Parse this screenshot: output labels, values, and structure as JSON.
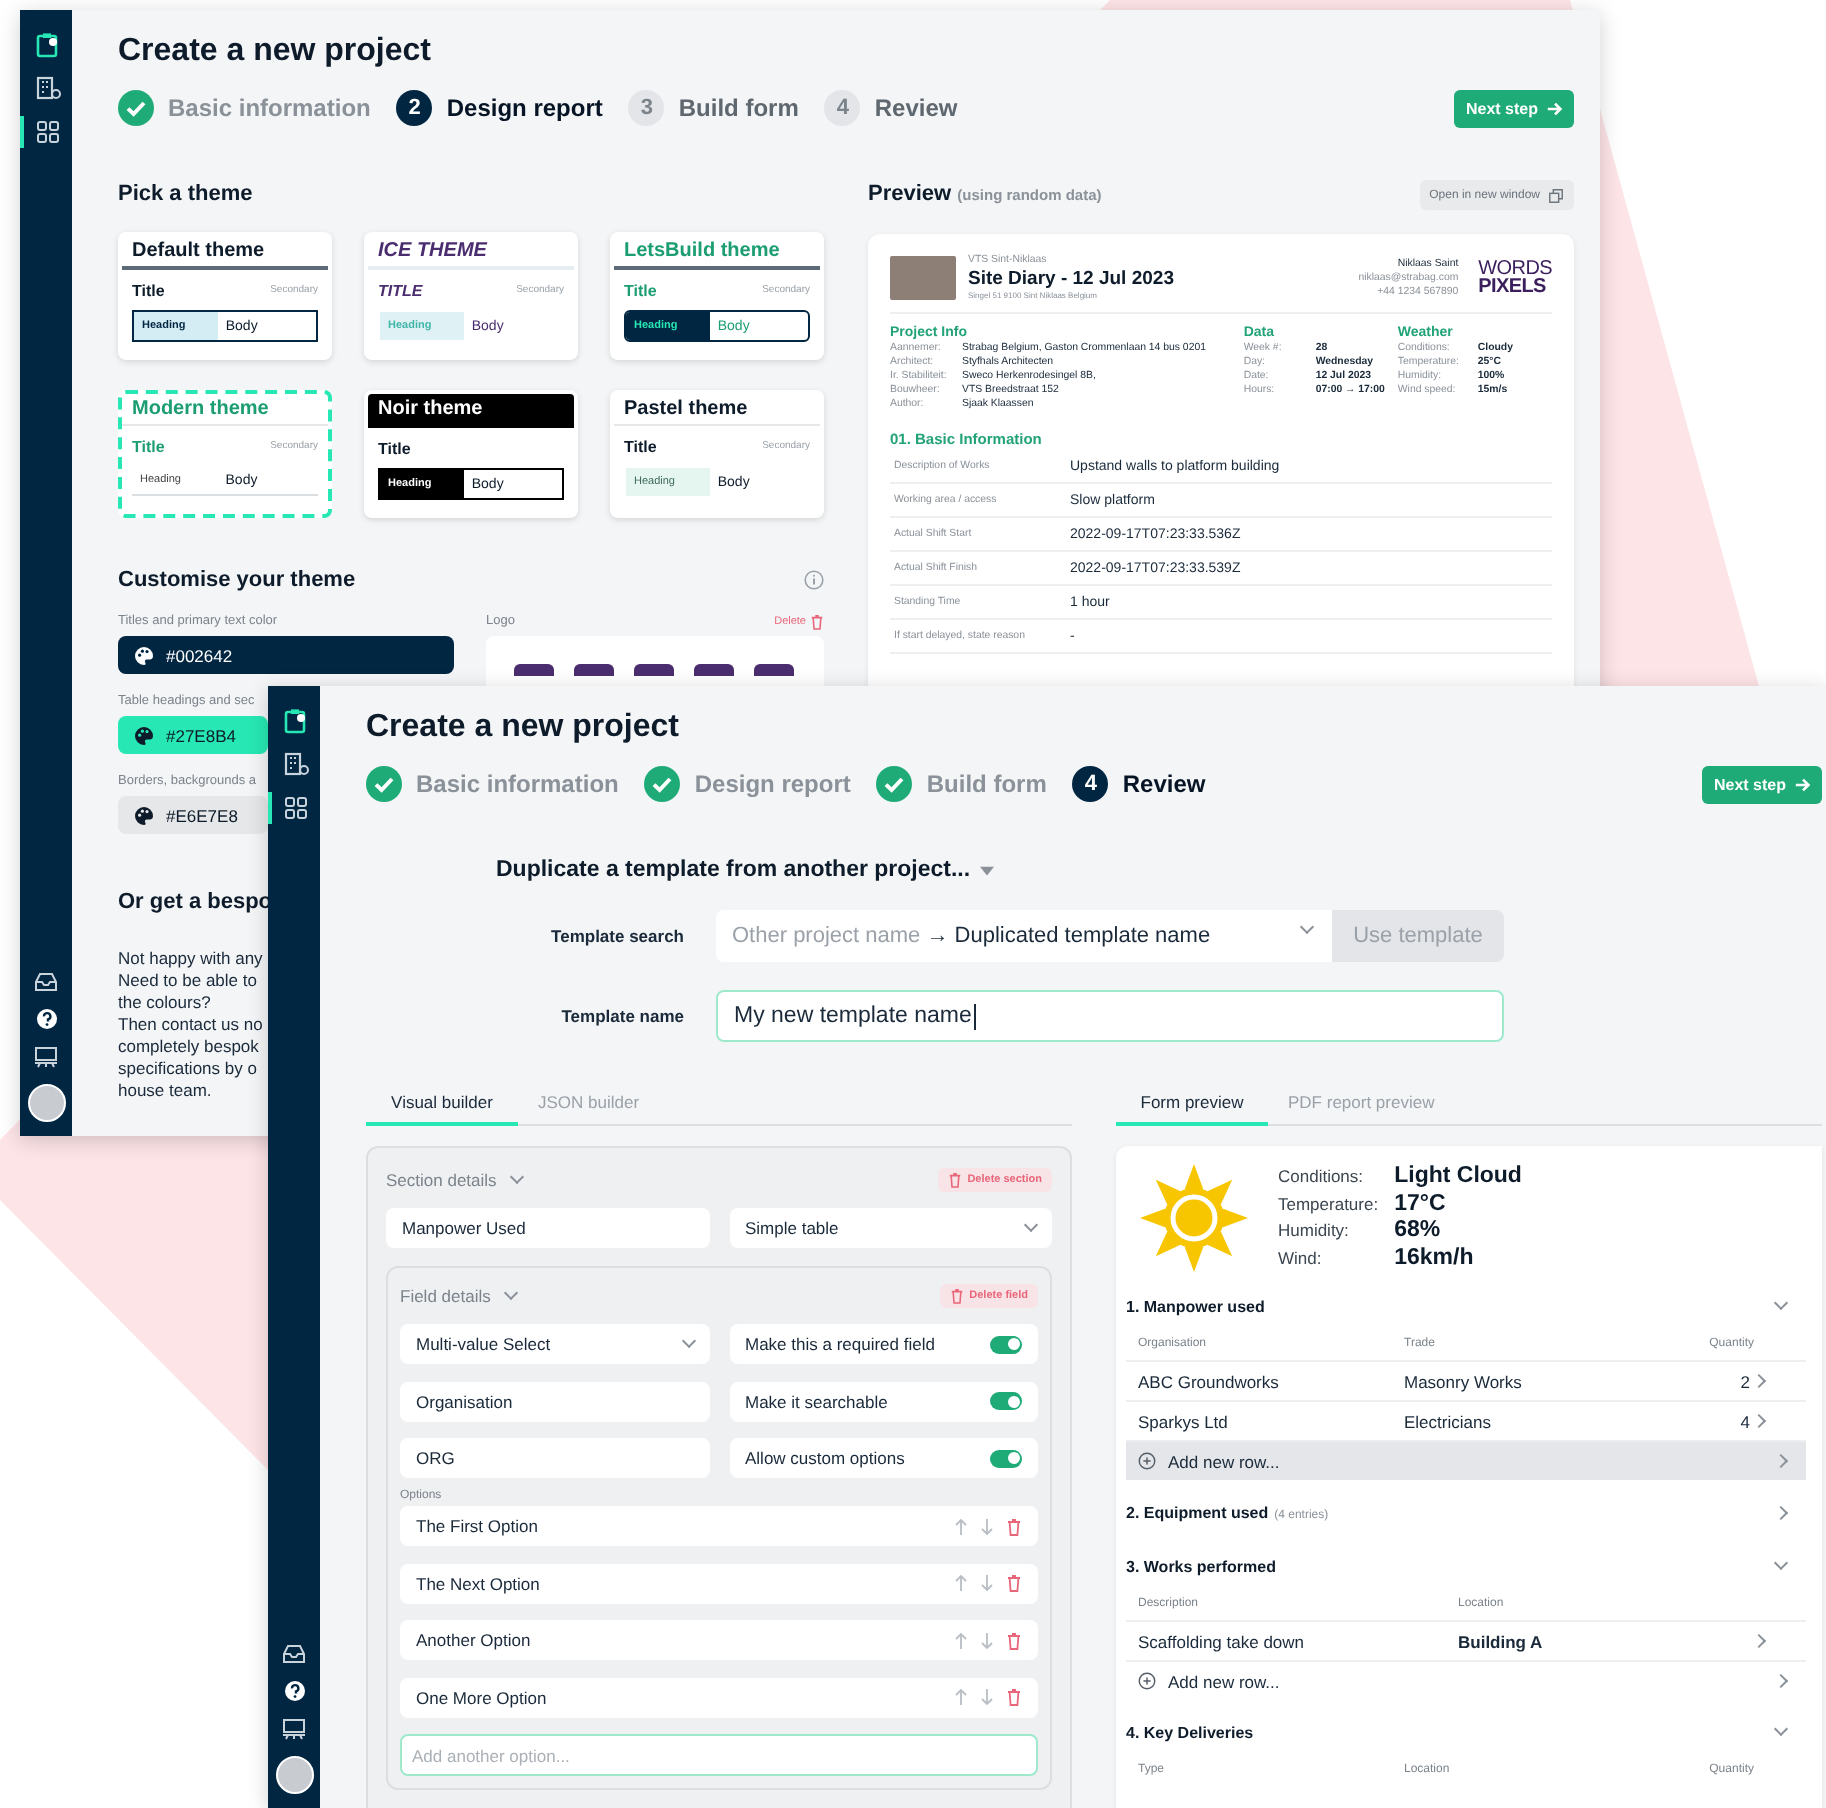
{
  "back_window": {
    "sidebar_items": [
      {
        "selected": false
      },
      {
        "selected": false
      },
      {
        "selected": true
      }
    ],
    "title": "Create a new project",
    "steps": [
      {
        "label": "Basic information",
        "done": true,
        "selected": false
      },
      {
        "number": "2",
        "label": "Design report",
        "done": false,
        "selected": true
      },
      {
        "number": "3",
        "label": "Build form",
        "done": false,
        "selected": false
      },
      {
        "number": "4",
        "label": "Review",
        "done": false,
        "selected": false
      }
    ],
    "next_button": "Next step",
    "themes_heading": "Pick a theme",
    "themes": [
      {
        "kind": "default",
        "name": "Default theme",
        "title": "Title",
        "secondary": "Secondary",
        "heading": "Heading",
        "body": "Body",
        "selected": false
      },
      {
        "kind": "ice",
        "name": "ICE THEME",
        "title": "TITLE",
        "secondary": "Secondary",
        "heading": "Heading",
        "body": "Body",
        "selected": false
      },
      {
        "kind": "letsbuild",
        "name": "LetsBuild theme",
        "title": "Title",
        "secondary": "Secondary",
        "heading": "Heading",
        "body": "Body",
        "selected": false
      },
      {
        "kind": "modern",
        "name": "Modern theme",
        "title": "Title",
        "secondary": "Secondary",
        "heading": "Heading",
        "body": "Body",
        "selected": true
      },
      {
        "kind": "noir",
        "name": "Noir theme",
        "title": "Title",
        "heading": "Heading",
        "body": "Body",
        "selected": false
      },
      {
        "kind": "pastel",
        "name": "Pastel theme",
        "title": "Title",
        "secondary": "Secondary",
        "heading": "Heading",
        "body": "Body",
        "selected": false
      }
    ],
    "customise": {
      "heading": "Customise your theme",
      "colors": [
        {
          "label": "Titles and primary text color",
          "value": "#002642",
          "color": "#002642"
        },
        {
          "label": "Table headings and sec",
          "value": "#27E8B4",
          "color": "#27e8b4"
        },
        {
          "label": "Borders, backgrounds a",
          "value": "#E6E7E8",
          "color": "#e6e7e8"
        }
      ],
      "logo_label": "Logo",
      "delete": "Delete"
    },
    "bespoke": {
      "heading": "Or get a bespo",
      "lines": [
        "Not happy with any",
        "Need to be able to",
        "the colours?",
        "Then contact us no",
        "completely bespok",
        "specifications by o",
        "house team."
      ]
    },
    "preview": {
      "heading": "Preview",
      "note": "(using random data)",
      "open_button": "Open in new window",
      "report": {
        "project": "VTS Sint-Niklaas",
        "title": "Site Diary - 12 Jul 2023",
        "address": "Singel 51 9100 Sint Niklaas Belgium",
        "contact": [
          "Niklaas Saint",
          "niklaas@strabag.com",
          "+44 1234 567890"
        ],
        "logo": [
          "WORDS",
          "PIXELS"
        ],
        "info_sections": [
          {
            "heading": "Project Info",
            "rows": [
              {
                "label": "Aannemer:",
                "value": "Strabag Belgium, Gaston Crommenlaan 14 bus 0201"
              },
              {
                "label": "Architect:",
                "value": "Styfhals Architecten"
              },
              {
                "label": "Ir. Stabiliteit:",
                "value": "Sweco Herkenrodesingel 8B,"
              },
              {
                "label": "Bouwheer:",
                "value": "VTS Breedstraat 152"
              },
              {
                "label": "Author:",
                "value": "Sjaak Klaassen"
              }
            ]
          },
          {
            "heading": "Data",
            "rows": [
              {
                "label": "Week #:",
                "value": "28"
              },
              {
                "label": "Day:",
                "value": "Wednesday"
              },
              {
                "label": "Date:",
                "value": "12 Jul 2023"
              },
              {
                "label": "Hours:",
                "value": "07:00 → 17:00"
              }
            ]
          },
          {
            "heading": "Weather",
            "rows": [
              {
                "label": "Conditions:",
                "value": "Cloudy"
              },
              {
                "label": "Temperature:",
                "value": "25°C"
              },
              {
                "label": "Humidity:",
                "value": "100%"
              },
              {
                "label": "Wind speed:",
                "value": "15m/s"
              }
            ]
          }
        ],
        "section_heading": "01. Basic Information",
        "rows": [
          {
            "label": "Description of Works",
            "value": "Upstand walls to platform building"
          },
          {
            "label": "Working area / access",
            "value": "Slow platform"
          },
          {
            "label": "Actual Shift Start",
            "value": "2022-09-17T07:23:33.536Z"
          },
          {
            "label": "Actual Shift Finish",
            "value": "2022-09-17T07:23:33.539Z"
          },
          {
            "label": "Standing Time",
            "value": "1 hour"
          },
          {
            "label": "If start delayed, state reason",
            "value": "-"
          }
        ]
      }
    }
  },
  "front_window": {
    "sidebar_items": [
      {
        "selected": false
      },
      {
        "selected": false
      },
      {
        "selected": true
      }
    ],
    "title": "Create a new project",
    "steps": [
      {
        "label": "Basic information",
        "done": true,
        "selected": false
      },
      {
        "label": "Design report",
        "done": true,
        "selected": false
      },
      {
        "label": "Build form",
        "done": true,
        "selected": false
      },
      {
        "number": "4",
        "label": "Review",
        "done": false,
        "selected": true
      }
    ],
    "next_button": "Next step",
    "duplicate_heading": "Duplicate a template from another project...",
    "template_search": {
      "label": "Template search",
      "source": "Other project name",
      "target": "→ Duplicated template name",
      "button": "Use template",
      "disabled": true
    },
    "template_name": {
      "label": "Template name",
      "value": "My new template name"
    },
    "builder_tabs": [
      {
        "label": "Visual builder",
        "selected": true
      },
      {
        "label": "JSON builder",
        "selected": false
      }
    ],
    "section": {
      "label": "Section details",
      "delete": "Delete section",
      "name": "Manpower Used",
      "type": "Simple table"
    },
    "field": {
      "label": "Field details",
      "delete": "Delete field",
      "type": "Multi-value Select",
      "name": "Organisation",
      "code": "ORG",
      "toggles": [
        {
          "label": "Make this a required field",
          "on": true
        },
        {
          "label": "Make it searchable",
          "on": true
        },
        {
          "label": "Allow custom options",
          "on": true
        }
      ],
      "options_label": "Options",
      "options": [
        "The First Option",
        "The Next Option",
        "Another Option",
        "One More Option"
      ],
      "placeholder": "Add another option..."
    },
    "preview_tabs": [
      {
        "label": "Form preview",
        "selected": true
      },
      {
        "label": "PDF report preview",
        "selected": false
      }
    ],
    "weather": [
      {
        "label": "Conditions:",
        "value": "Light Cloud"
      },
      {
        "label": "Temperature:",
        "value": "17°C"
      },
      {
        "label": "Humidity:",
        "value": "68%"
      },
      {
        "label": "Wind:",
        "value": "16km/h"
      }
    ],
    "form_sections": [
      {
        "title": "1. Manpower used",
        "expanded": true,
        "columns": [
          "Organisation",
          "Trade",
          "Quantity"
        ],
        "rows": [
          [
            "ABC Groundworks",
            "Masonry Works",
            "2"
          ],
          [
            "Sparkys Ltd",
            "Electricians",
            "4"
          ]
        ],
        "add_row": {
          "label": "Add new row...",
          "highlighted": true
        }
      },
      {
        "title": "2. Equipment used",
        "note": "(4 entries)",
        "expanded": false
      },
      {
        "title": "3. Works performed",
        "expanded": true,
        "columns": [
          "Description",
          "Location"
        ],
        "rows": [
          [
            "Scaffolding take down",
            "Building A"
          ]
        ],
        "add_row": {
          "label": "Add new row...",
          "highlighted": false
        }
      },
      {
        "title": "4. Key Deliveries",
        "expanded": true,
        "columns": [
          "Type",
          "Location",
          "Quantity"
        ]
      }
    ]
  }
}
